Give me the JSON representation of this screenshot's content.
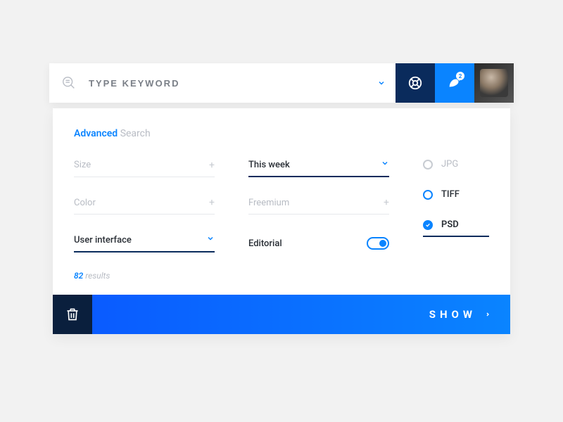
{
  "search": {
    "placeholder": "TYPE KEYWORD",
    "notification_count": "2"
  },
  "panel": {
    "title_advanced": "Advanced",
    "title_search": "Search",
    "fields": {
      "size": "Size",
      "color": "Color",
      "category": "User interface",
      "timeframe": "This week",
      "pricing": "Freemium",
      "editorial": "Editorial"
    },
    "formats": {
      "jpg": "JPG",
      "tiff": "TIFF",
      "psd": "PSD"
    },
    "results_count": "82",
    "results_label": "results"
  },
  "footer": {
    "show": "SHOW"
  }
}
